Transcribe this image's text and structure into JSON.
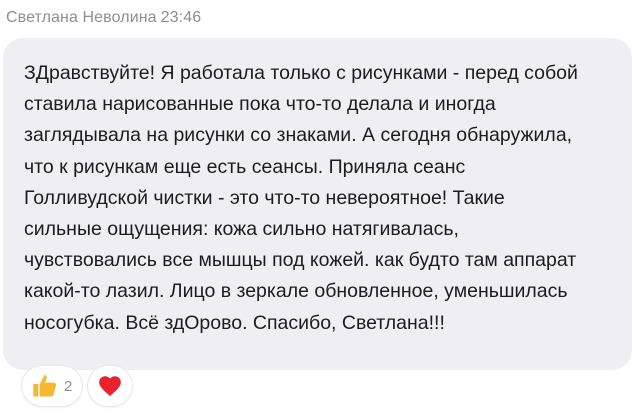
{
  "header": {
    "author": "Светлана Неволина",
    "time": "23:46"
  },
  "message": {
    "text": "ЗДравствуйте! Я работала только с рисунками - перед собой\nставила нарисованные пока что-то делала и иногда\nзаглядывала на рисунки со знаками. А сегодня обнаружила,\nчто к рисункам еще есть сеансы. Приняла сеанс\nГолливудской чистки - это что-то невероятное! Такие\nсильные ощущения: кожа сильно натягивалась,\nчувствовались все мышцы под кожей. как будто там аппарат\nкакой-то лазил. Лицо в зеркале обновленное, уменьшилась\nносогубка. Всё здОрово. Спасибо, Светлана!!!"
  },
  "reactions": [
    {
      "icon": "thumbs-up-icon",
      "count": "2",
      "color": "#f5b82e"
    },
    {
      "icon": "heart-icon",
      "count": "",
      "color": "#e8222c"
    }
  ],
  "colors": {
    "bubble": "#efeff3",
    "meta_text": "#8e8e93",
    "message_text": "#1c1c1e"
  }
}
